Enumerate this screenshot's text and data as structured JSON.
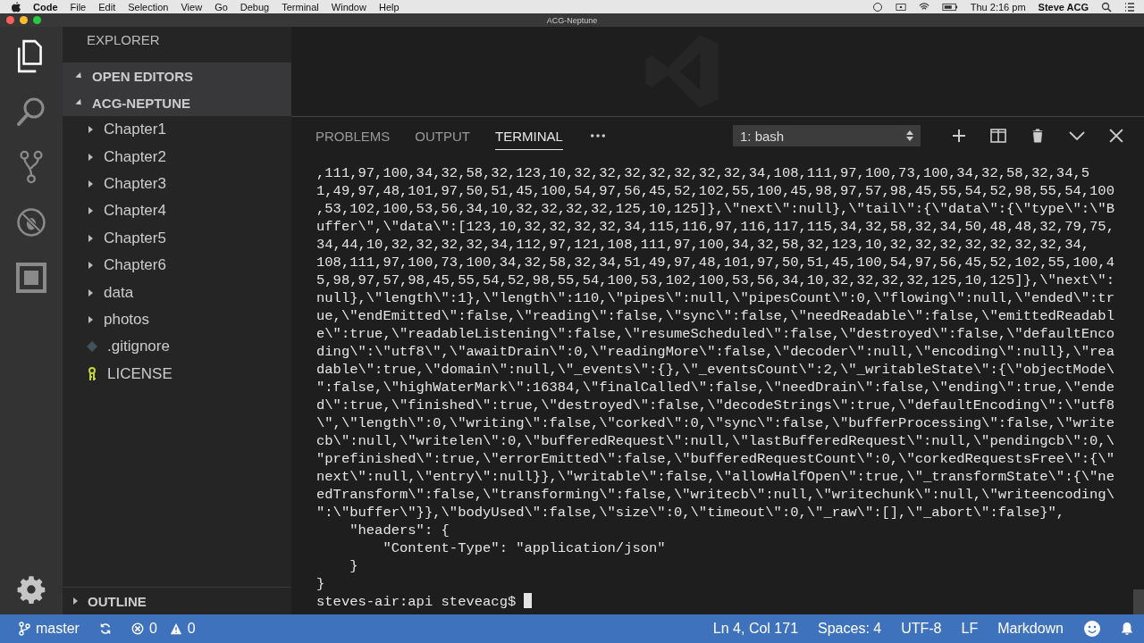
{
  "menu_bar": {
    "app": "Code",
    "items": [
      "File",
      "Edit",
      "Selection",
      "View",
      "Go",
      "Debug",
      "Terminal",
      "Window",
      "Help"
    ],
    "clock": "Thu 2:16 pm",
    "user": "Steve ACG"
  },
  "window": {
    "title": "ACG-Neptune"
  },
  "activity_bar": [
    {
      "kind": "files",
      "selected": true
    },
    {
      "kind": "search",
      "selected": false
    },
    {
      "kind": "source-control",
      "selected": false
    },
    {
      "kind": "debug",
      "selected": false
    },
    {
      "kind": "extensions",
      "selected": false
    }
  ],
  "sidebar": {
    "title": "EXPLORER",
    "sections": [
      {
        "label": "OPEN EDITORS",
        "expanded": true
      },
      {
        "label": "ACG-NEPTUNE",
        "expanded": true,
        "children": [
          {
            "label": "Chapter1",
            "kind": "folder",
            "expanded": false
          },
          {
            "label": "Chapter2",
            "kind": "folder",
            "expanded": false
          },
          {
            "label": "Chapter3",
            "kind": "folder",
            "expanded": false
          },
          {
            "label": "Chapter4",
            "kind": "folder",
            "expanded": false
          },
          {
            "label": "Chapter5",
            "kind": "folder",
            "expanded": false
          },
          {
            "label": "Chapter6",
            "kind": "folder",
            "expanded": false
          },
          {
            "label": "data",
            "kind": "folder",
            "expanded": false
          },
          {
            "label": "photos",
            "kind": "folder",
            "expanded": false
          },
          {
            "label": ".gitignore",
            "kind": "git"
          },
          {
            "label": "LICENSE",
            "kind": "license"
          }
        ]
      }
    ],
    "outline": {
      "label": "OUTLINE",
      "expanded": false
    }
  },
  "panel": {
    "tabs": [
      {
        "label": "PROBLEMS",
        "selected": false
      },
      {
        "label": "OUTPUT",
        "selected": false
      },
      {
        "label": "TERMINAL",
        "selected": true
      }
    ],
    "terminal_select": "1: bash",
    "lines": [
      ",111,97,100,34,32,58,32,123,10,32,32,32,32,32,32,32,34,108,111,97,100,73,100,34,32,58,32,34,5",
      "1,49,97,48,101,97,50,51,45,100,54,97,56,45,52,102,55,100,45,98,97,57,98,45,55,54,52,98,55,54,100",
      ",53,102,100,53,56,34,10,32,32,32,32,125,10,125]},\\\"next\\\":null},\\\"tail\\\":{\\\"data\\\":{\\\"type\\\":\\\"B",
      "uffer\\\",\\\"data\\\":[123,10,32,32,32,32,34,115,116,97,116,117,115,34,32,58,32,34,50,48,48,32,79,75,",
      "34,44,10,32,32,32,32,34,112,97,121,108,111,97,100,34,32,58,32,123,10,32,32,32,32,32,32,32,34,",
      "108,111,97,100,73,100,34,32,58,32,34,51,49,97,48,101,97,50,51,45,100,54,97,56,45,52,102,55,100,4",
      "5,98,97,57,98,45,55,54,52,98,55,54,100,53,102,100,53,56,34,10,32,32,32,32,125,10,125]},\\\"next\\\":",
      "null},\\\"length\\\":1},\\\"length\\\":110,\\\"pipes\\\":null,\\\"pipesCount\\\":0,\\\"flowing\\\":null,\\\"ended\\\":tr",
      "ue,\\\"endEmitted\\\":false,\\\"reading\\\":false,\\\"sync\\\":false,\\\"needReadable\\\":false,\\\"emittedReadabl",
      "e\\\":true,\\\"readableListening\\\":false,\\\"resumeScheduled\\\":false,\\\"destroyed\\\":false,\\\"defaultEnco",
      "ding\\\":\\\"utf8\\\",\\\"awaitDrain\\\":0,\\\"readingMore\\\":false,\\\"decoder\\\":null,\\\"encoding\\\":null},\\\"rea",
      "dable\\\":true,\\\"domain\\\":null,\\\"_events\\\":{},\\\"_eventsCount\\\":2,\\\"_writableState\\\":{\\\"objectMode\\",
      "\":false,\\\"highWaterMark\\\":16384,\\\"finalCalled\\\":false,\\\"needDrain\\\":false,\\\"ending\\\":true,\\\"ende",
      "d\\\":true,\\\"finished\\\":true,\\\"destroyed\\\":false,\\\"decodeStrings\\\":true,\\\"defaultEncoding\\\":\\\"utf8",
      "\\\",\\\"length\\\":0,\\\"writing\\\":false,\\\"corked\\\":0,\\\"sync\\\":false,\\\"bufferProcessing\\\":false,\\\"write",
      "cb\\\":null,\\\"writelen\\\":0,\\\"bufferedRequest\\\":null,\\\"lastBufferedRequest\\\":null,\\\"pendingcb\\\":0,\\",
      "\"prefinished\\\":true,\\\"errorEmitted\\\":false,\\\"bufferedRequestCount\\\":0,\\\"corkedRequestsFree\\\":{\\\"",
      "next\\\":null,\\\"entry\\\":null}},\\\"writable\\\":false,\\\"allowHalfOpen\\\":true,\\\"_transformState\\\":{\\\"ne",
      "edTransform\\\":false,\\\"transforming\\\":false,\\\"writecb\\\":null,\\\"writechunk\\\":null,\\\"writeencoding\\",
      "\":\\\"buffer\\\"}},\\\"bodyUsed\\\":false,\\\"size\\\":0,\\\"timeout\\\":0,\\\"_raw\\\":[],\\\"_abort\\\":false}\",",
      "    \"headers\": {",
      "        \"Content-Type\": \"application/json\"",
      "    }",
      "}"
    ],
    "prompt": "steves-air:api steveacg$"
  },
  "status_bar": {
    "branch": "master",
    "errors": "0",
    "warnings": "0",
    "position": "Ln 4, Col 171",
    "spaces": "Spaces: 4",
    "encoding": "UTF-8",
    "eol": "LF",
    "language": "Markdown"
  }
}
